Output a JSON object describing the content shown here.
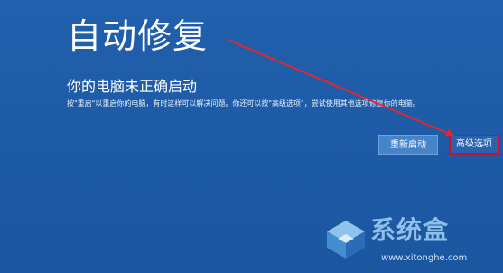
{
  "screen": {
    "title": "自动修复",
    "subtitle": "你的电脑未正确启动",
    "description": "按\"重启\"以重启你的电脑，有时这样可以解决问题。你还可以按\"高级选项\"，尝试使用其他选项修复你的电脑。"
  },
  "buttons": {
    "restart_label": "重新启动",
    "advanced_label": "高级选项"
  },
  "watermark": {
    "brand": "系统盒",
    "url": "www.xitonghe.com"
  },
  "colors": {
    "background": "#1e5aa8",
    "highlight_border": "#c8102e",
    "arrow": "#e0282e"
  }
}
